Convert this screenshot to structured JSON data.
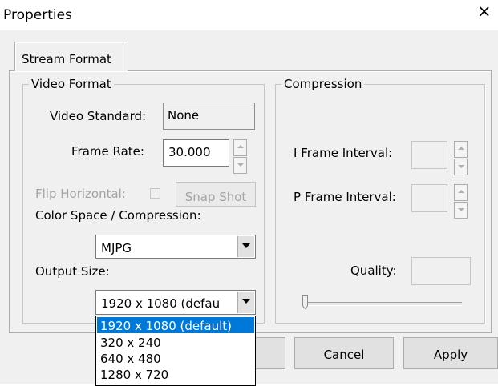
{
  "window": {
    "title": "Properties",
    "close_glyph": "×"
  },
  "tabs": [
    {
      "label": "Stream Format",
      "active": true
    }
  ],
  "video_format": {
    "legend": "Video Format",
    "video_standard_label": "Video Standard:",
    "video_standard_value": "None",
    "frame_rate_label": "Frame Rate:",
    "frame_rate_value": "30.000",
    "flip_horizontal_label": "Flip Horizontal:",
    "flip_horizontal_checked": false,
    "snap_shot_label": "Snap Shot",
    "color_space_label": "Color Space / Compression:",
    "color_space_value": "MJPG",
    "output_size_label": "Output Size:",
    "output_size_value": "1920 x 1080  (defau",
    "output_size_options": [
      "1920 x 1080  (default)",
      "320 x 240",
      "640 x 480",
      "1280 x 720"
    ],
    "output_size_selected_index": 0
  },
  "compression": {
    "legend": "Compression",
    "i_frame_label": "I Frame Interval:",
    "i_frame_value": "",
    "p_frame_label": "P Frame Interval:",
    "p_frame_value": "",
    "quality_label": "Quality:",
    "quality_value": "",
    "quality_slider_fraction": 0
  },
  "buttons": {
    "ok_label": "",
    "cancel_label": "Cancel",
    "apply_label": "Apply"
  },
  "colors": {
    "face": "#f0f0f0",
    "selection": "#0078d7",
    "disabled_text": "#a3a3a3"
  }
}
